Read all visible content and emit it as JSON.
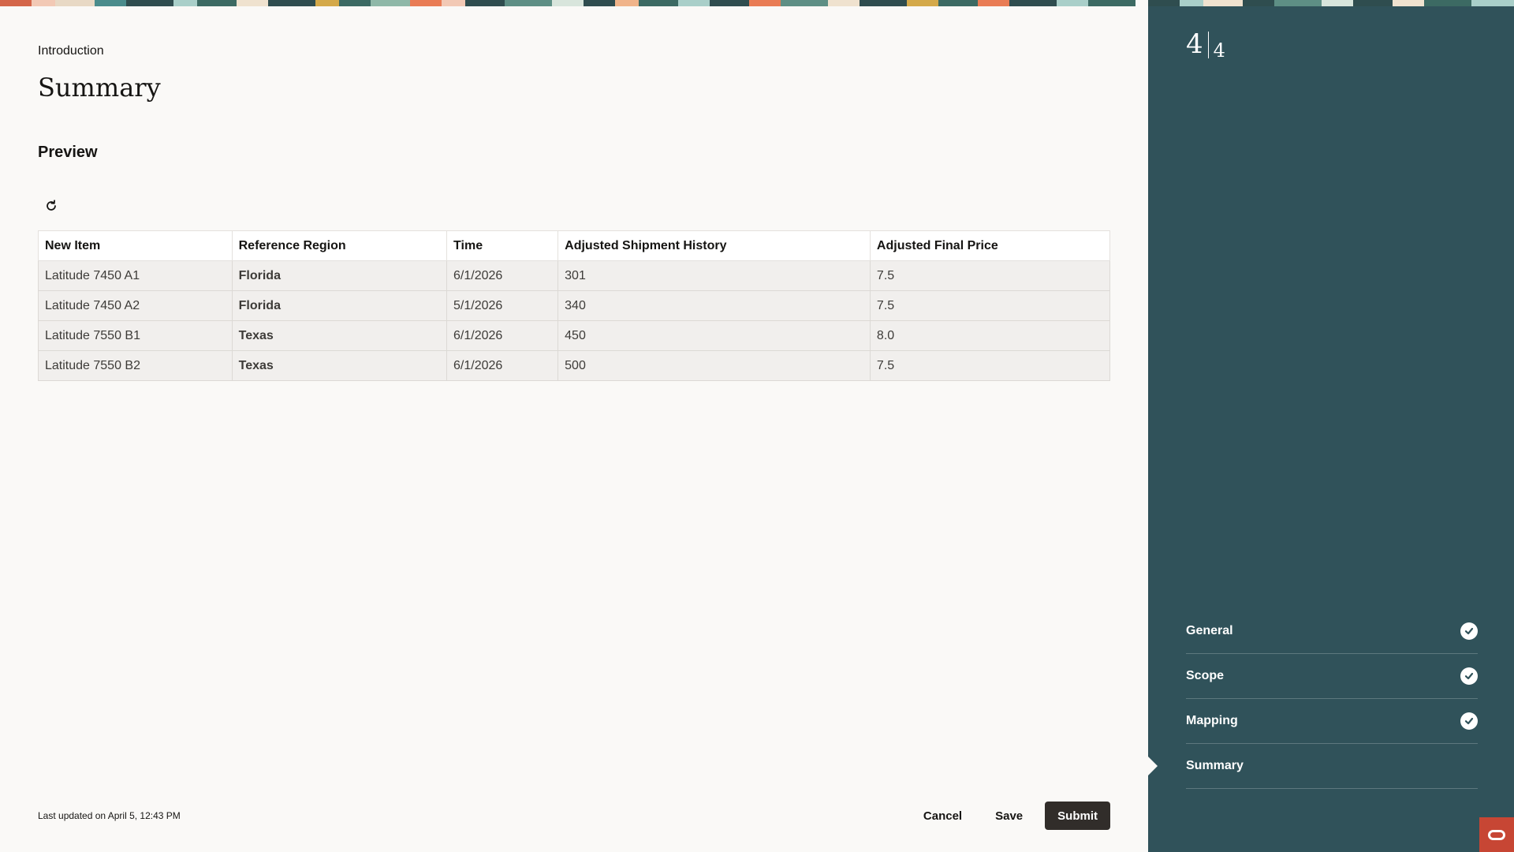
{
  "breadcrumb": "Introduction",
  "page_title": "Summary",
  "section_title": "Preview",
  "refresh_icon": "refresh-icon",
  "table": {
    "columns": [
      "New Item",
      "Reference Region",
      "Time",
      "Adjusted Shipment History",
      "Adjusted Final Price"
    ],
    "rows": [
      [
        "Latitude 7450 A1",
        "Florida",
        "6/1/2026",
        "301",
        "7.5"
      ],
      [
        "Latitude 7450 A2",
        "Florida",
        "5/1/2026",
        "340",
        "7.5"
      ],
      [
        "Latitude 7550 B1",
        "Texas",
        "6/1/2026",
        "450",
        "8.0"
      ],
      [
        "Latitude 7550 B2",
        "Texas",
        "6/1/2026",
        "500",
        "7.5"
      ]
    ]
  },
  "footer": {
    "last_updated": "Last updated on April 5, 12:43 PM",
    "cancel_label": "Cancel",
    "save_label": "Save",
    "submit_label": "Submit"
  },
  "side_panel": {
    "step_current": "4",
    "step_total": "4",
    "steps": [
      {
        "label": "General",
        "completed": true
      },
      {
        "label": "Scope",
        "completed": true
      },
      {
        "label": "Mapping",
        "completed": true
      },
      {
        "label": "Summary",
        "completed": false
      }
    ]
  },
  "colors": {
    "panel_bg": "#30525a",
    "primary_button": "#312d2a",
    "page_bg": "#faf9f7",
    "badge": "#c74634"
  }
}
